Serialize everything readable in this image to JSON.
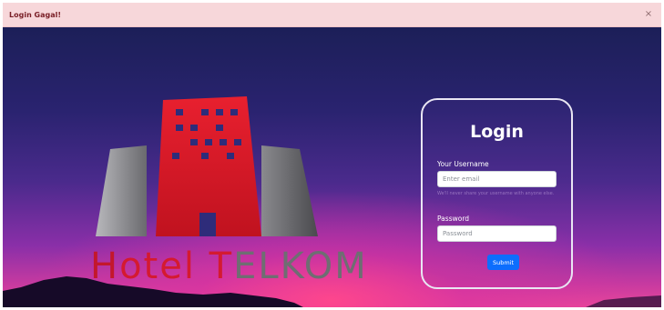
{
  "alert": {
    "message": "Login Gagal!",
    "close_symbol": "×"
  },
  "logo": {
    "part1": "H",
    "part2": "otel ",
    "part3": "T",
    "part4": "ELKOM"
  },
  "login": {
    "title": "Login",
    "username_label": "Your Username",
    "username_placeholder": "Enter email",
    "username_help": "We'll never share your username with anyone else.",
    "password_label": "Password",
    "password_placeholder": "Password",
    "submit_label": "Submit"
  },
  "colors": {
    "alert_bg": "#f7d7da",
    "alert_text": "#7a1f27",
    "logo_red": "#d41a30",
    "logo_gray": "#6e6e72",
    "submit_blue": "#0d6efd"
  }
}
